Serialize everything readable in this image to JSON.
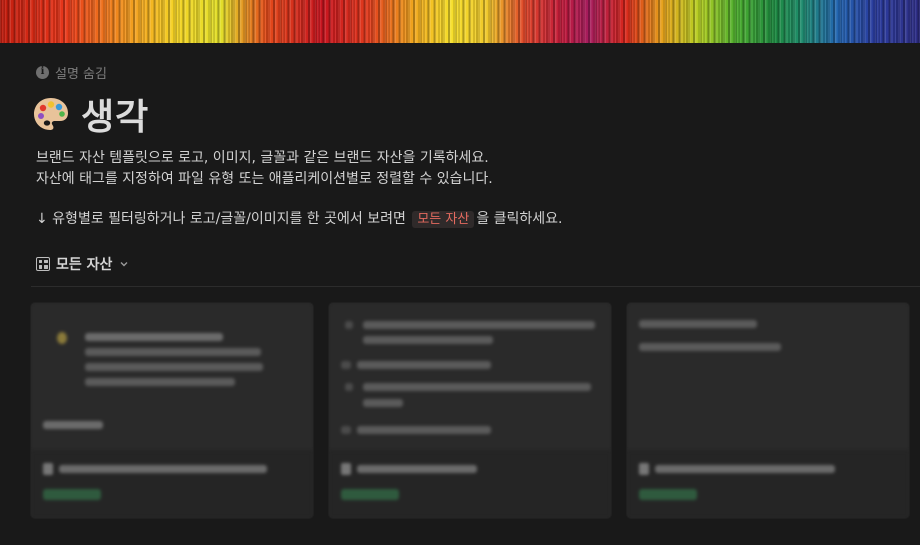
{
  "cover": {
    "description": ""
  },
  "page": {
    "hide_description_label": "설명 숨김",
    "title": "생각",
    "icon": "palette-icon",
    "description_line_1": "브랜드 자산 템플릿으로 로고, 이미지, 글꼴과 같은 브랜드 자산을 기록하세요.",
    "description_line_2": "자산에 태그를 지정하여 파일 유형 또는 애플리케이션별로 정렬할 수 있습니다.",
    "description_line_3_prefix": "↓ 유형별로 필터링하거나 로고/글꼴/이미지를 한 곳에서 보려면",
    "description_line_3_code": "모든 자산",
    "description_line_3_suffix": "을 클릭하세요."
  },
  "view": {
    "label": "모든 자산",
    "icon": "gallery-icon"
  },
  "colors": {
    "background": "#191919",
    "inline_code_text": "#e46a5f",
    "inline_code_bg": "#2f2a2a",
    "tag_green": "#2f5a3e"
  }
}
